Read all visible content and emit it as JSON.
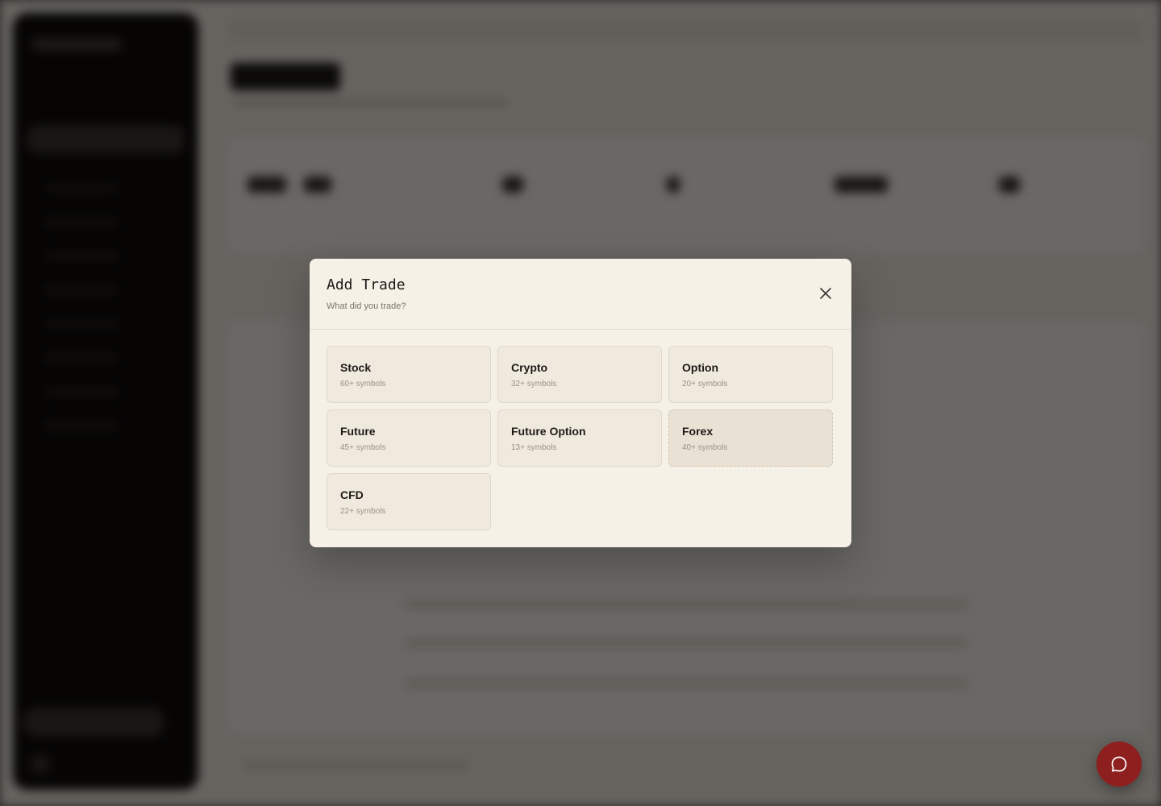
{
  "modal": {
    "title": "Add Trade",
    "subtitle": "What did you trade?",
    "close_icon": "close-icon"
  },
  "trade_types": [
    {
      "label": "Stock",
      "count": "60+ symbols"
    },
    {
      "label": "Crypto",
      "count": "32+ symbols"
    },
    {
      "label": "Option",
      "count": "20+ symbols"
    },
    {
      "label": "Future",
      "count": "45+ symbols"
    },
    {
      "label": "Future Option",
      "count": "13+ symbols"
    },
    {
      "label": "Forex",
      "count": "40+ symbols"
    },
    {
      "label": "CFD",
      "count": "22+ symbols"
    }
  ],
  "chat_button": {
    "icon": "chat-bubble-icon",
    "color": "#8e1f1f"
  },
  "colors": {
    "modal_bg": "#f6f1e7",
    "card_bg": "#f0e9de",
    "overlay": "rgba(0,0,0,0.58)"
  }
}
